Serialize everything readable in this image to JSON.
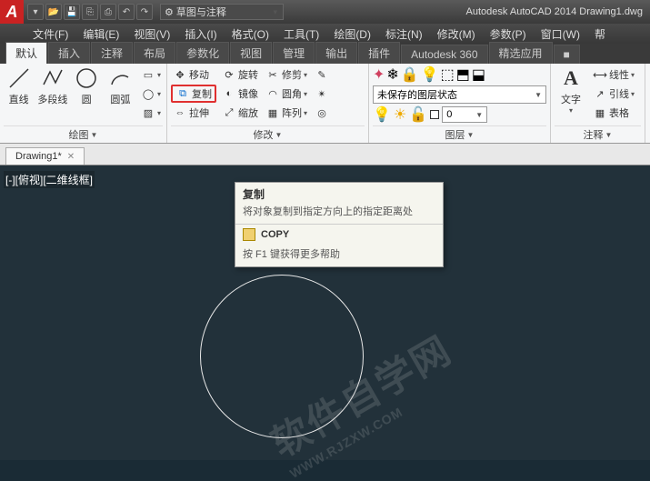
{
  "title": "Autodesk AutoCAD 2014   Drawing1.dwg",
  "workspace": "草图与注释",
  "menus": [
    "文件(F)",
    "编辑(E)",
    "视图(V)",
    "插入(I)",
    "格式(O)",
    "工具(T)",
    "绘图(D)",
    "标注(N)",
    "修改(M)",
    "参数(P)",
    "窗口(W)",
    "帮"
  ],
  "ribbon_tabs": [
    "默认",
    "插入",
    "注释",
    "布局",
    "参数化",
    "视图",
    "管理",
    "输出",
    "插件",
    "Autodesk 360",
    "精选应用",
    "■"
  ],
  "draw_panel": {
    "title": "绘图",
    "btns": {
      "line": "直线",
      "polyline": "多段线",
      "circle": "圆",
      "arc": "圆弧"
    }
  },
  "modify_panel": {
    "title": "修改",
    "move": "移动",
    "copy": "复制",
    "stretch": "拉伸",
    "rotate": "旋转",
    "mirror": "镜像",
    "scale": "缩放",
    "trim": "修剪",
    "fillet": "圆角",
    "array": "阵列"
  },
  "layer_panel": {
    "title": "图层",
    "state": "未保存的图层状态",
    "current": "0"
  },
  "annotation_panel": {
    "title": "注释",
    "text": "文字",
    "linear": "线性",
    "leader": "引线",
    "table": "表格"
  },
  "file_tab": "Drawing1*",
  "viewport_label": "[-][俯视][二维线框]",
  "tooltip": {
    "title": "复制",
    "desc": "将对象复制到指定方向上的指定距离处",
    "cmd": "COPY",
    "help": "按 F1 键获得更多帮助"
  },
  "watermark": {
    "cn": "软件自学网",
    "url": "WWW.RJZXW.COM"
  }
}
